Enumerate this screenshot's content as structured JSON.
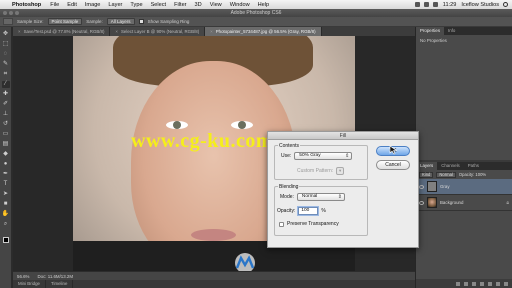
{
  "menubar": {
    "app_name": "Photoshop",
    "items": [
      "File",
      "Edit",
      "Image",
      "Layer",
      "Type",
      "Select",
      "Filter",
      "3D",
      "View",
      "Window",
      "Help"
    ],
    "clock": "11:29",
    "user": "Iceflow Studios"
  },
  "window": {
    "title": "Adobe Photoshop CS6"
  },
  "options": {
    "sample_label": "Sample Size:",
    "sample_value": "Point Sample",
    "sample2_label": "Sample:",
    "sample2_value": "All Layers",
    "ring_label": "Show Sampling Ring"
  },
  "tools": [
    "eyedropper",
    "move",
    "marquee",
    "lasso",
    "quick-select",
    "crop",
    "eyedropper-active",
    "healing",
    "brush",
    "clone-stamp",
    "history-brush",
    "eraser",
    "gradient",
    "blur",
    "dodge",
    "pen",
    "type",
    "path-select",
    "shape",
    "hand",
    "zoom"
  ],
  "doc_tabs": [
    {
      "label": "Save/Test.psd @ 77.8% (Neutral, RGB/8)"
    },
    {
      "label": "Select Layer B @ 90% (Neutral, RGB/8)"
    },
    {
      "label": "Photopainter_5734487.jpg @ 56.5% (Gray, RGB/8)"
    }
  ],
  "canvas": {
    "watermark": "www.cg-ku.com"
  },
  "statusbar": {
    "zoom": "56.6%",
    "doc_info": "Doc: 11.6M/13.2M"
  },
  "bottom_tabs": [
    "Mini Bridge",
    "Timeline"
  ],
  "right_panel": {
    "props_tabs": [
      "Properties",
      "Info"
    ],
    "props_text": "No Properties",
    "layers_tabs": [
      "Layers",
      "Channels",
      "Paths"
    ],
    "kind_label": "Kind",
    "blend_mode": "Normal",
    "opacity_label": "Opacity: 100%",
    "layers": [
      {
        "name": "Gray"
      },
      {
        "name": "Background"
      }
    ]
  },
  "dialog": {
    "title": "Fill",
    "contents_label": "Contents",
    "use_label": "Use:",
    "use_value": "50% Gray",
    "custom_pattern_label": "Custom Pattern:",
    "blending_label": "Blending",
    "mode_label": "Mode:",
    "mode_value": "Normal",
    "opacity_label": "Opacity:",
    "opacity_value": "100",
    "percent": "%",
    "preserve_label": "Preserve Transparency",
    "ok_label": "OK",
    "cancel_label": "Cancel"
  }
}
